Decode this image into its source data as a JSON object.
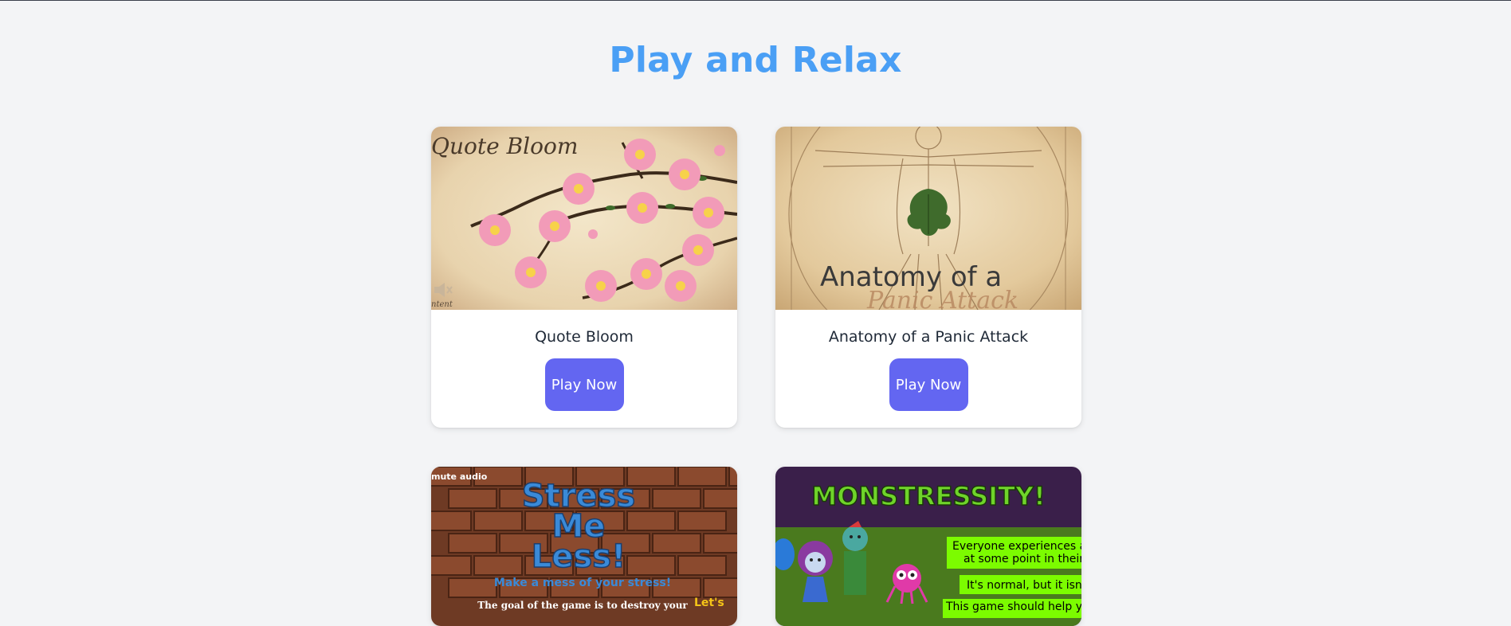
{
  "page": {
    "title": "Play and Relax"
  },
  "cards": [
    {
      "title": "Quote Bloom",
      "button_label": "Play Now",
      "thumbnail": {
        "logo_text": "Quote Bloom",
        "corner_text": "ntent",
        "icon": "speaker-mute-icon"
      }
    },
    {
      "title": "Anatomy of a Panic Attack",
      "button_label": "Play Now",
      "thumbnail": {
        "heading_text": "Anatomy of a",
        "script_text": "Panic Attack"
      }
    },
    {
      "title": "",
      "button_label": "",
      "thumbnail": {
        "corner_text": "mute audio",
        "line1": "Stress",
        "line2": "Me",
        "line3": "Less!",
        "tagline": "Make a mess of your stress!",
        "footer_text": "The goal of the game is to destroy your",
        "badge_text": "Let's"
      }
    },
    {
      "title": "",
      "button_label": "",
      "thumbnail": {
        "logo_text": "MONSTRESSITY!",
        "box1_line1": "Everyone experiences an",
        "box1_line2": "at some point in their lif",
        "box2": "It's normal, but it isn't e",
        "box3": "This game should help you"
      }
    }
  ],
  "colors": {
    "background": "#f3f4f6",
    "title": "#4a9ff5",
    "button": "#6366f1",
    "card": "#ffffff"
  }
}
